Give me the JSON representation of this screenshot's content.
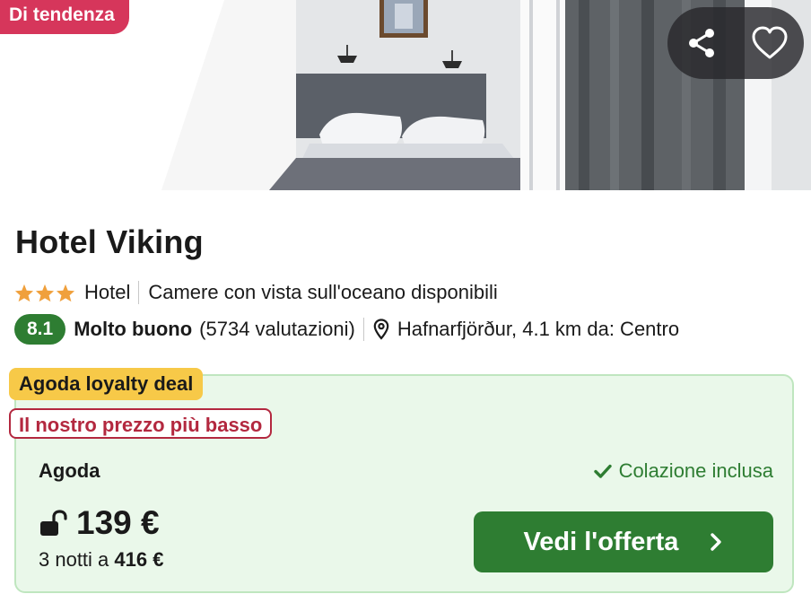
{
  "hero": {
    "badge": "Di tendenza",
    "share_icon": "share-icon",
    "favorite_icon": "heart-icon"
  },
  "hotel": {
    "name": "Hotel Viking",
    "star_count": 3,
    "type": "Hotel",
    "feature": "Camere con vista sull'oceano disponibili",
    "score": "8.1",
    "rating_label": "Molto buono",
    "reviews": "(5734 valutazioni)",
    "location": "Hafnarfjörður, 4.1 km da: Centro"
  },
  "deal": {
    "loyalty_badge": "Agoda loyalty deal",
    "lowest_badge": "Il nostro prezzo più basso",
    "provider": "Agoda",
    "breakfast": "Colazione inclusa",
    "price": "139 €",
    "nights_prefix": "3 notti a",
    "total": "416 €",
    "cta_label": "Vedi l'offerta"
  },
  "colors": {
    "trend_badge": "#d6365b",
    "score_green": "#2e7d32",
    "card_bg": "#eaf8ea",
    "loyalty_yellow": "#f7c948",
    "lowest_red": "#b3283f",
    "star": "#f0a03c"
  }
}
